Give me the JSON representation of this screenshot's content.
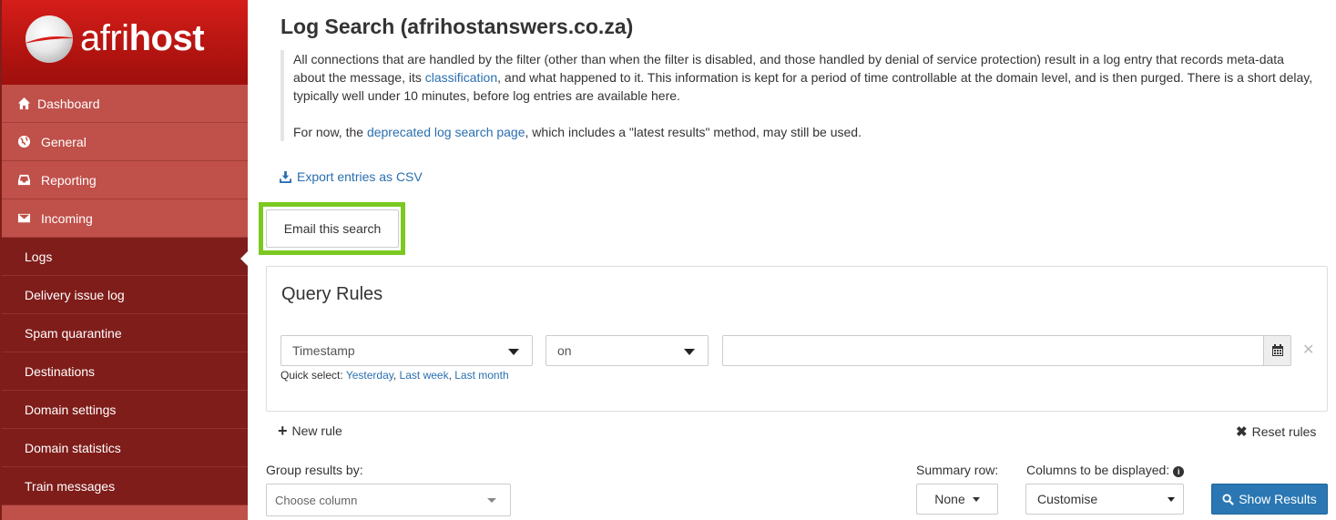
{
  "brand": {
    "logo_thin": "afri",
    "logo_bold": "host"
  },
  "sidebar": {
    "top_items": [
      {
        "label": "Dashboard",
        "icon": "home-icon"
      },
      {
        "label": "General",
        "icon": "globe-icon"
      },
      {
        "label": "Reporting",
        "icon": "inbox-icon"
      },
      {
        "label": "Incoming",
        "icon": "envelope-icon"
      }
    ],
    "sub_items": [
      {
        "label": "Logs",
        "active": true
      },
      {
        "label": "Delivery issue log"
      },
      {
        "label": "Spam quarantine"
      },
      {
        "label": "Destinations"
      },
      {
        "label": "Domain settings"
      },
      {
        "label": "Domain statistics"
      },
      {
        "label": "Train messages"
      }
    ]
  },
  "main": {
    "title": "Log Search (afrihostanswers.co.za)",
    "intro": {
      "p1_before": "All connections that are handled by the filter (other than when the filter is disabled, and those handled by denial of service protection) result in a log entry that records meta-data about the message, its ",
      "p1_link": "classification",
      "p1_after": ", and what happened to it. This information is kept for a period of time controllable at the domain level, and is then purged. There is a short delay, typically well under 10 minutes, before log entries are available here.",
      "p2_before": "For now, the ",
      "p2_link": "deprecated log search page",
      "p2_after": ", which includes a \"latest results\" method, may still be used."
    },
    "export_label": "Export entries as CSV",
    "email_button": "Email this search",
    "highlight_color": "#7bc920",
    "query": {
      "title": "Query Rules",
      "field_select": "Timestamp",
      "operator_select": "on",
      "date_value": "",
      "quick_label": "Quick select:",
      "quick_options": [
        "Yesterday",
        "Last week",
        "Last month"
      ]
    },
    "new_rule": "New rule",
    "reset_rules": "Reset rules",
    "group_label": "Group results by:",
    "group_placeholder": "Choose column",
    "summary_label": "Summary row:",
    "summary_value": "None",
    "columns_label": "Columns to be displayed:",
    "columns_value": "Customise",
    "show_results": "Show Results"
  },
  "colors": {
    "sidebar_top": "#c0504a",
    "sidebar_sub": "#7f1d1a",
    "link": "#2a6fb0",
    "primary": "#2a77b3"
  }
}
